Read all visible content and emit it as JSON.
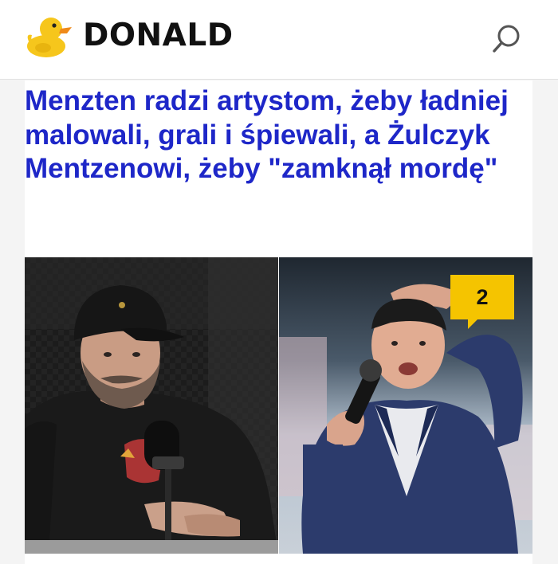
{
  "header": {
    "brand": "DONALD",
    "logo_icon": "duck-icon",
    "search_icon": "search-icon"
  },
  "article": {
    "headline": "Menzten radzi artystom, żeby ładniej malowali, grali i śpiewali, a Żulczyk Mentzenowi, żeby \"zamknął mordę\"",
    "comment_count": "2",
    "headline_color": "#1e27c8",
    "badge_color": "#f5c400"
  }
}
